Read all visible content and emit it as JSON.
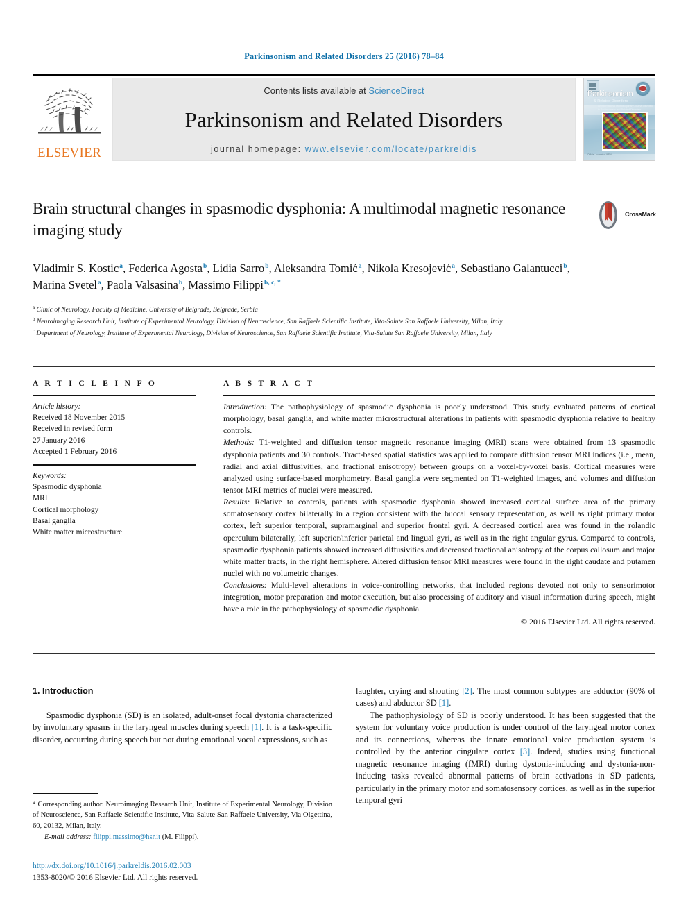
{
  "running_head": "Parkinsonism and Related Disorders 25 (2016) 78–84",
  "banner": {
    "publisher_name": "ELSEVIER",
    "publisher_logo_icon": "elsevier-tree-icon",
    "contents_prefix": "Contents lists available at ",
    "contents_link": "ScienceDirect",
    "journal_title": "Parkinsonism and Related Disorders",
    "homepage_prefix": "journal homepage: ",
    "homepage_url": "www.elsevier.com/locate/parkreldis",
    "cover": {
      "masthead": "Parkinsonism",
      "sub": "& Related Disorders",
      "tagline": "An International Multidisciplinary Journal\nDevoted to Parkinsonism and Related Disorders",
      "footer": "Official Journal of\nWFN"
    }
  },
  "crossmark": {
    "label": "CrossMark",
    "icon": "crossmark-icon"
  },
  "article": {
    "title": "Brain structural changes in spasmodic dysphonia: A multimodal magnetic resonance imaging study",
    "authors": [
      {
        "name": "Vladimir S. Kostic",
        "sup": "a",
        "sep": ", "
      },
      {
        "name": "Federica Agosta",
        "sup": "b",
        "sep": ", "
      },
      {
        "name": "Lidia Sarro",
        "sup": "b",
        "sep": ", "
      },
      {
        "name": "Aleksandra Tomić",
        "sup": "a",
        "sep": ", "
      },
      {
        "name": "Nikola Kresojević",
        "sup": "a",
        "sep": ", "
      },
      {
        "name": "Sebastiano Galantucci",
        "sup": "b",
        "sep": ", "
      },
      {
        "name": "Marina Svetel",
        "sup": "a",
        "sep": ", "
      },
      {
        "name": "Paola Valsasina",
        "sup": "b",
        "sep": ", "
      },
      {
        "name": "Massimo Filippi",
        "sup": "b, c, *",
        "sep": ""
      }
    ],
    "affiliations": [
      {
        "marker": "a",
        "text": "Clinic of Neurology, Faculty of Medicine, University of Belgrade, Belgrade, Serbia"
      },
      {
        "marker": "b",
        "text": "Neuroimaging Research Unit, Institute of Experimental Neurology, Division of Neuroscience, San Raffaele Scientific Institute, Vita-Salute San Raffaele University, Milan, Italy"
      },
      {
        "marker": "c",
        "text": "Department of Neurology, Institute of Experimental Neurology, Division of Neuroscience, San Raffaele Scientific Institute, Vita-Salute San Raffaele University, Milan, Italy"
      }
    ]
  },
  "article_info": {
    "heading": "A R T I C L E  I N F O",
    "history_label": "Article history:",
    "history": [
      "Received 18 November 2015",
      "Received in revised form",
      "27 January 2016",
      "Accepted 1 February 2016"
    ],
    "keywords_label": "Keywords:",
    "keywords": [
      "Spasmodic dysphonia",
      "MRI",
      "Cortical morphology",
      "Basal ganglia",
      "White matter microstructure"
    ]
  },
  "abstract": {
    "heading": "A B S T R A C T",
    "sections": [
      {
        "label": "Introduction:",
        "text": " The pathophysiology of spasmodic dysphonia is poorly understood. This study evaluated patterns of cortical morphology, basal ganglia, and white matter microstructural alterations in patients with spasmodic dysphonia relative to healthy controls."
      },
      {
        "label": "Methods:",
        "text": " T1-weighted and diffusion tensor magnetic resonance imaging (MRI) scans were obtained from 13 spasmodic dysphonia patients and 30 controls. Tract-based spatial statistics was applied to compare diffusion tensor MRI indices (i.e., mean, radial and axial diffusivities, and fractional anisotropy) between groups on a voxel-by-voxel basis. Cortical measures were analyzed using surface-based morphometry. Basal ganglia were segmented on T1-weighted images, and volumes and diffusion tensor MRI metrics of nuclei were measured."
      },
      {
        "label": "Results:",
        "text": " Relative to controls, patients with spasmodic dysphonia showed increased cortical surface area of the primary somatosensory cortex bilaterally in a region consistent with the buccal sensory representation, as well as right primary motor cortex, left superior temporal, supramarginal and superior frontal gyri. A decreased cortical area was found in the rolandic operculum bilaterally, left superior/inferior parietal and lingual gyri, as well as in the right angular gyrus. Compared to controls, spasmodic dysphonia patients showed increased diffusivities and decreased fractional anisotropy of the corpus callosum and major white matter tracts, in the right hemisphere. Altered diffusion tensor MRI measures were found in the right caudate and putamen nuclei with no volumetric changes."
      },
      {
        "label": "Conclusions:",
        "text": " Multi-level alterations in voice-controlling networks, that included regions devoted not only to sensorimotor integration, motor preparation and motor execution, but also processing of auditory and visual information during speech, might have a role in the pathophysiology of spasmodic dysphonia."
      }
    ],
    "copyright": "© 2016 Elsevier Ltd. All rights reserved."
  },
  "body": {
    "section_number_title": "1. Introduction",
    "left_paragraphs": [
      "Spasmodic dysphonia (SD) is an isolated, adult-onset focal dystonia characterized by involuntary spasms in the laryngeal muscles during speech [1]. It is a task-specific disorder, occurring during speech but not during emotional vocal expressions, such as"
    ],
    "right_paragraphs": [
      "laughter, crying and shouting [2]. The most common subtypes are adductor (90% of cases) and abductor SD [1].",
      "The pathophysiology of SD is poorly understood. It has been suggested that the system for voluntary voice production is under control of the laryngeal motor cortex and its connections, whereas the innate emotional voice production system is controlled by the anterior cingulate cortex [3]. Indeed, studies using functional magnetic resonance imaging (fMRI) during dystonia-inducing and dystonia-non-inducing tasks revealed abnormal patterns of brain activations in SD patients, particularly in the primary motor and somatosensory cortices, as well as in the superior temporal gyri"
    ]
  },
  "footnote": {
    "star": "*",
    "text": " Corresponding author. Neuroimaging Research Unit, Institute of Experimental Neurology, Division of Neuroscience, San Raffaele Scientific Institute, Vita-Salute San Raffaele University, Via Olgettina, 60, 20132, Milan, Italy.",
    "email_label": "E-mail address:",
    "email": "filippi.massimo@hsr.it",
    "email_suffix": " (M. Filippi)."
  },
  "doi": {
    "url": "http://dx.doi.org/10.1016/j.parkreldis.2016.02.003",
    "issn_line": "1353-8020/© 2016 Elsevier Ltd. All rights reserved."
  },
  "colors": {
    "link_blue": "#1f7fb5",
    "header_blue": "#0b6ea8",
    "elsevier_orange": "#e87722",
    "banner_grey": "#e9e9e9"
  }
}
